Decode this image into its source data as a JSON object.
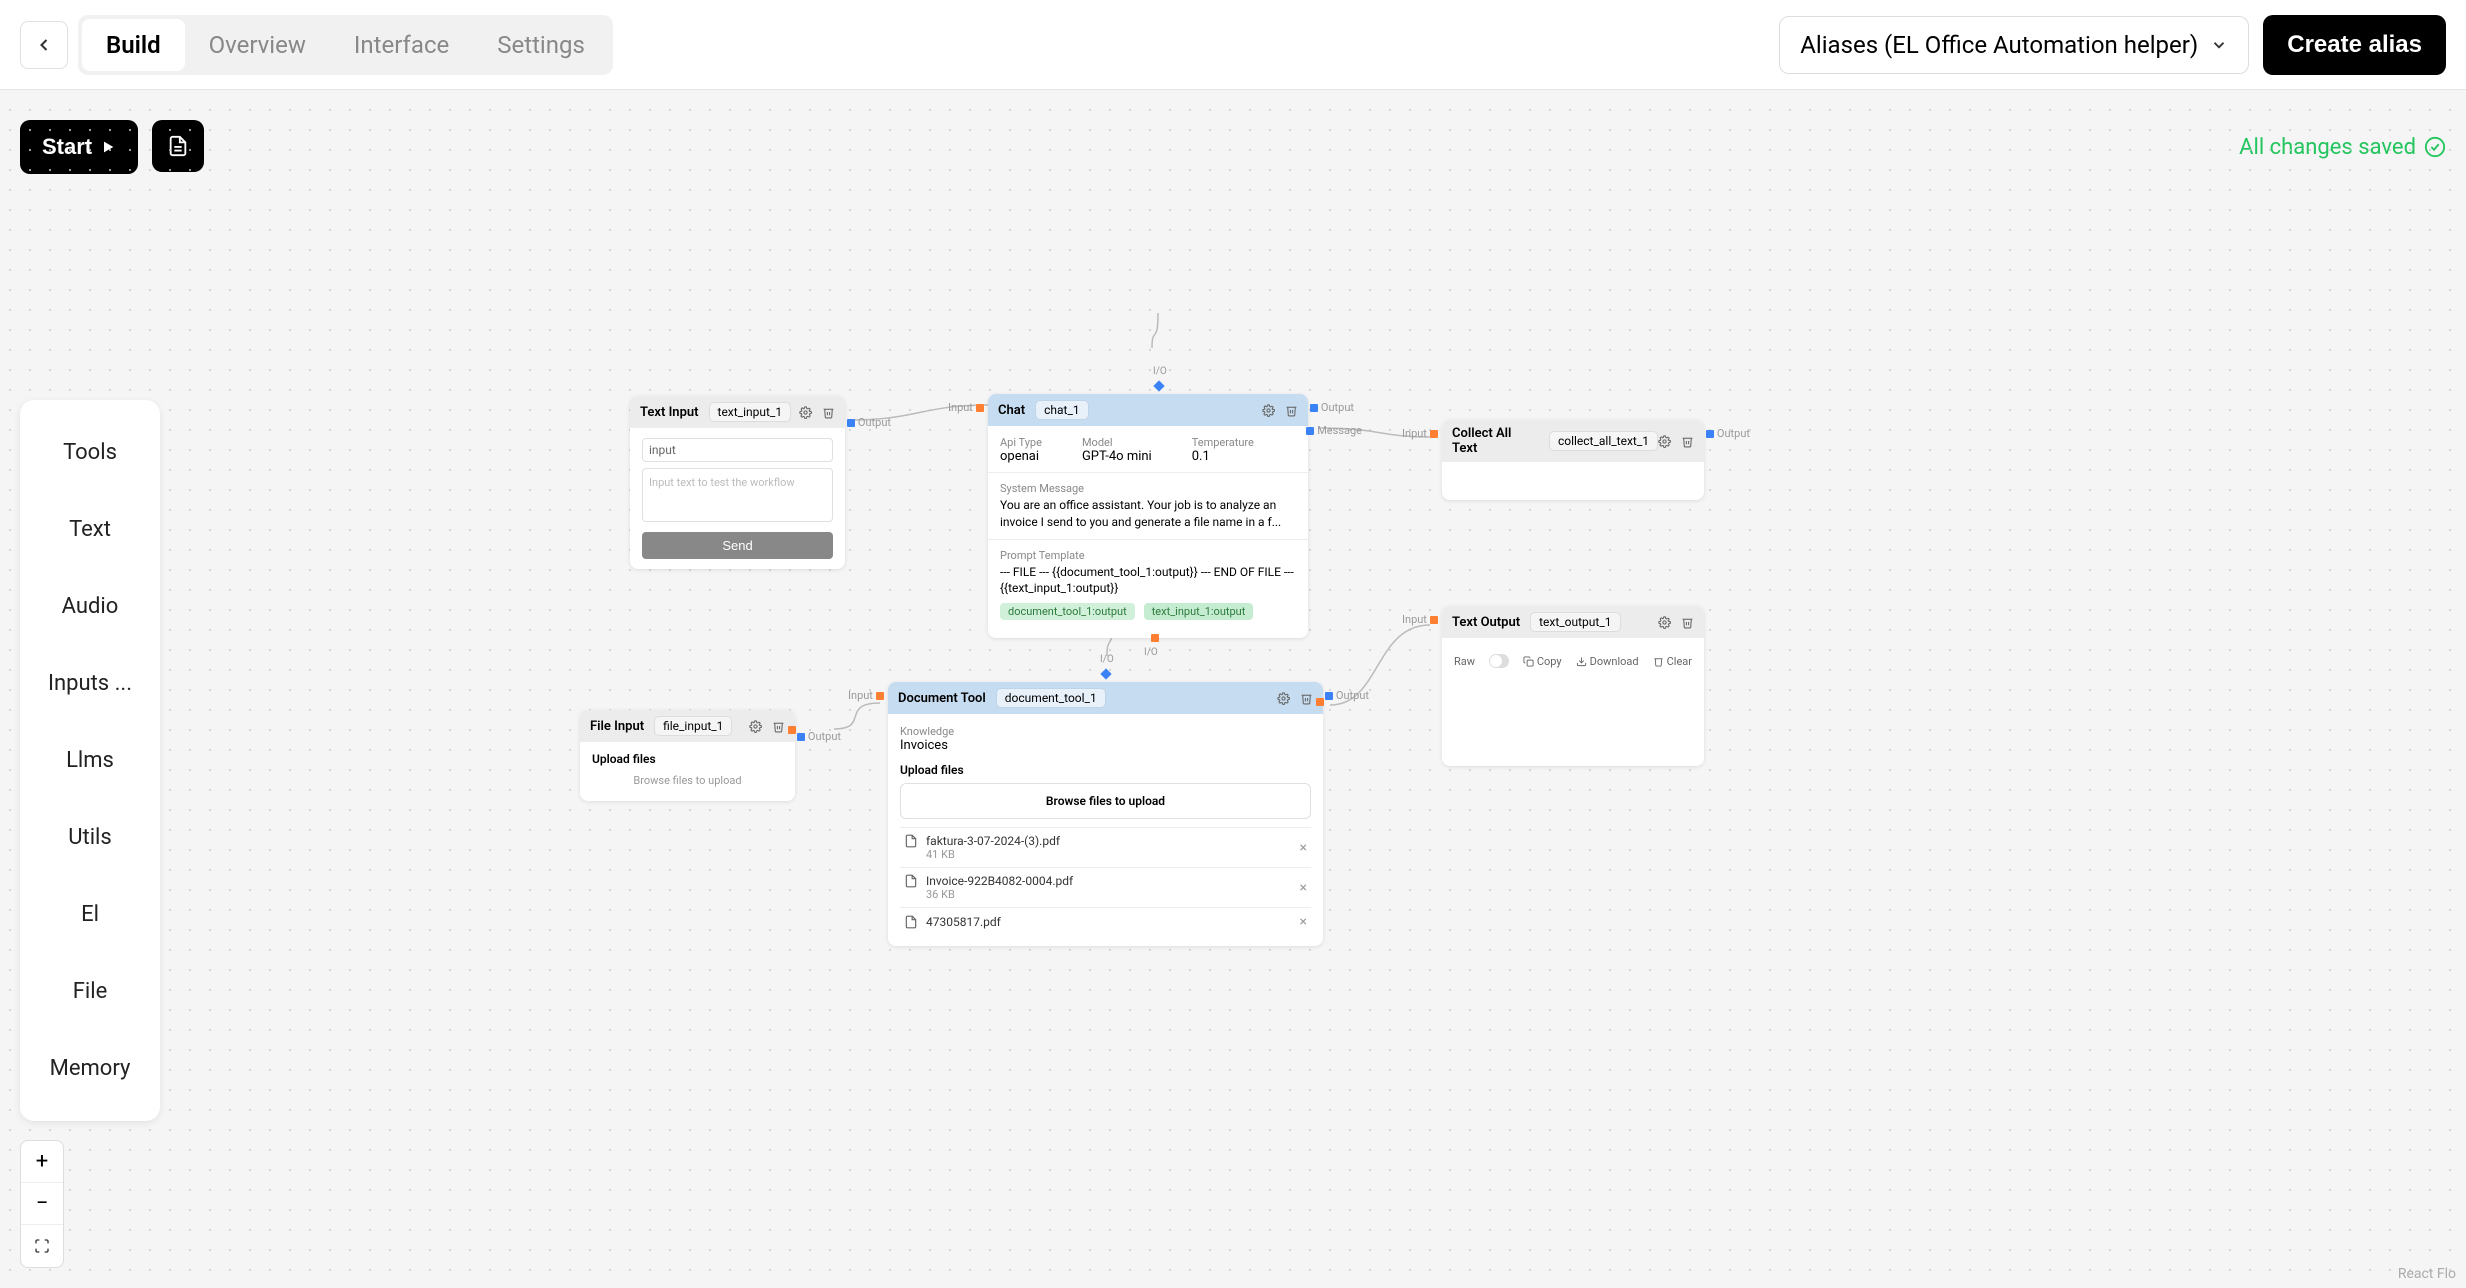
{
  "topbar": {
    "tabs": {
      "build": "Build",
      "overview": "Overview",
      "interface": "Interface",
      "settings": "Settings"
    },
    "alias_select": "Aliases (EL Office Automation helper)",
    "create_alias": "Create alias"
  },
  "actions": {
    "start": "Start",
    "save_status": "All changes saved"
  },
  "sidebar": {
    "items": [
      "Tools",
      "Text",
      "Audio",
      "Inputs ...",
      "Llms",
      "Utils",
      "El",
      "File",
      "Memory"
    ]
  },
  "ports": {
    "input": "Input",
    "output": "Output",
    "message": "Message",
    "io": "I/O"
  },
  "nodes": {
    "text_input": {
      "type": "Text Input",
      "id": "text_input_1",
      "name_label": "input",
      "placeholder": "Input text to test the workflow",
      "send": "Send"
    },
    "file_input": {
      "type": "File Input",
      "id": "file_input_1",
      "upload_label": "Upload files",
      "browse": "Browse files to upload"
    },
    "chat": {
      "type": "Chat",
      "id": "chat_1",
      "api_type_label": "Api Type",
      "api_type": "openai",
      "model_label": "Model",
      "model": "GPT-4o mini",
      "temp_label": "Temperature",
      "temp": "0.1",
      "sys_label": "System Message",
      "sys_msg": "You are an office assistant. Your job is to analyze an invoice I send to you and generate a file name in a f...",
      "prompt_label": "Prompt Template",
      "prompt": "--- FILE --- {{document_tool_1:output}} --- END OF FILE --- {{text_input_1:output}}",
      "tag1": "document_tool_1:output",
      "tag2": "text_input_1:output"
    },
    "document_tool": {
      "type": "Document Tool",
      "id": "document_tool_1",
      "knowledge_label": "Knowledge",
      "knowledge": "Invoices",
      "upload_label": "Upload files",
      "browse": "Browse files to upload",
      "files": [
        {
          "name": "faktura-3-07-2024-(3).pdf",
          "size": "41 KB"
        },
        {
          "name": "Invoice-922B4082-0004.pdf",
          "size": "36 KB"
        },
        {
          "name": "47305817.pdf",
          "size": ""
        }
      ]
    },
    "collect_all": {
      "type": "Collect All Text",
      "id": "collect_all_text_1"
    },
    "text_output": {
      "type": "Text Output",
      "id": "text_output_1",
      "raw": "Raw",
      "copy": "Copy",
      "download": "Download",
      "clear": "Clear"
    }
  },
  "footer": {
    "brand": "React Flo"
  }
}
